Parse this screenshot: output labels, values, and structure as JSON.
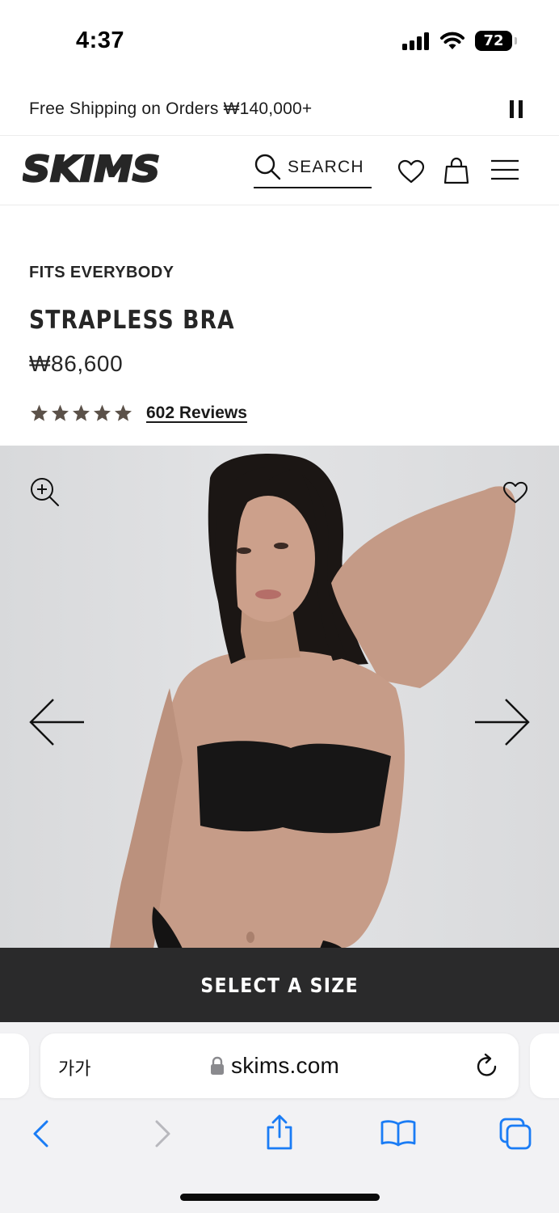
{
  "status_bar": {
    "time": "4:37",
    "battery": "72"
  },
  "promo": {
    "text": "Free Shipping on Orders ₩140,000+"
  },
  "header": {
    "logo_text": "SKIMS",
    "search_label": "SEARCH"
  },
  "product": {
    "collection": "FITS EVERYBODY",
    "title": "STRAPLESS BRA",
    "price": "₩86,600",
    "rating": 5,
    "reviews_label": "602 Reviews"
  },
  "cta": {
    "label": "SELECT A SIZE"
  },
  "browser": {
    "aa_label": "가가",
    "url": "skims.com"
  },
  "colors": {
    "accent": "#2a2a2b",
    "stars": "#5b5149",
    "ios_blue": "#1a7cf5"
  },
  "icons": [
    "search-icon",
    "heart-icon",
    "bag-icon",
    "menu-icon",
    "zoom-in-icon",
    "arrow-left-icon",
    "arrow-right-icon",
    "lock-icon",
    "reload-icon",
    "back-icon",
    "forward-icon",
    "share-icon",
    "bookmarks-icon",
    "tabs-icon"
  ]
}
